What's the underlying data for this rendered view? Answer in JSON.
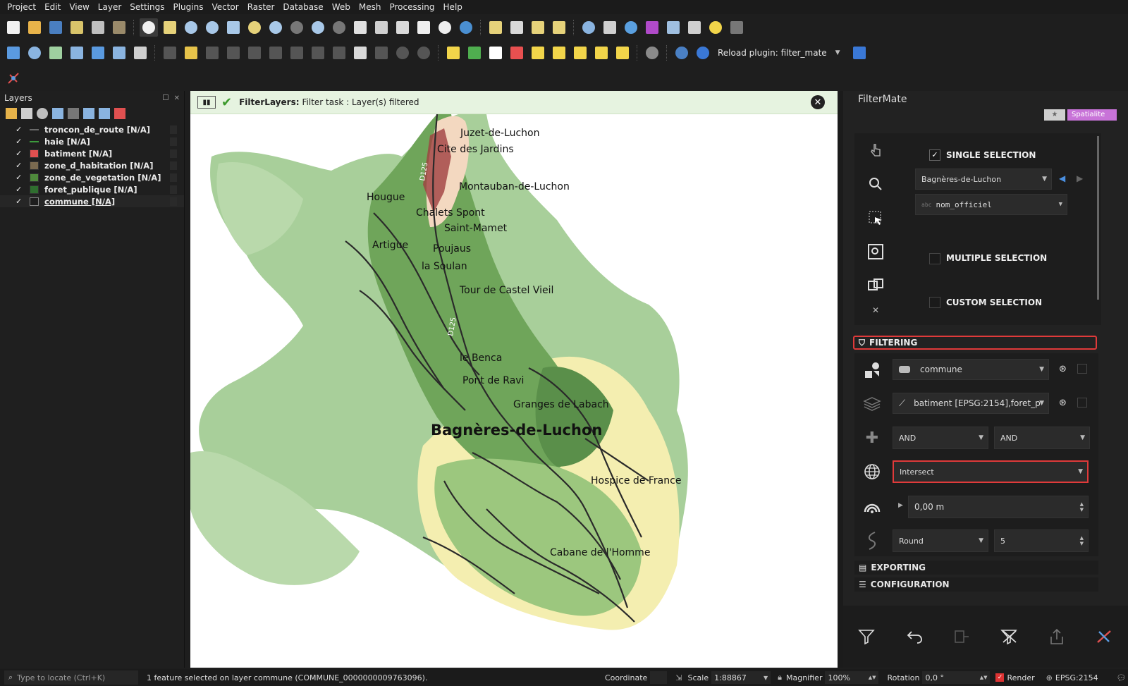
{
  "menubar": {
    "items": [
      "Project",
      "Edit",
      "View",
      "Layer",
      "Settings",
      "Plugins",
      "Vector",
      "Raster",
      "Database",
      "Web",
      "Mesh",
      "Processing",
      "Help"
    ]
  },
  "toolbar2": {
    "reload_label": "Reload plugin: filter_mate"
  },
  "layers_panel": {
    "title": "Layers",
    "layers": [
      {
        "name": "troncon_de_route [N/A]",
        "color": "#6b6b6b",
        "type": "line",
        "checked": true
      },
      {
        "name": "haie [N/A]",
        "color": "#3c9a3c",
        "type": "line",
        "checked": true
      },
      {
        "name": "batiment [N/A]",
        "color": "#e05050",
        "type": "poly",
        "checked": true
      },
      {
        "name": "zone_d_habitation [N/A]",
        "color": "#7a6a50",
        "type": "poly",
        "checked": true
      },
      {
        "name": "zone_de_vegetation [N/A]",
        "color": "#4f8a3c",
        "type": "poly",
        "checked": true
      },
      {
        "name": "foret_publique [N/A]",
        "color": "#2f6e2f",
        "type": "poly",
        "checked": true
      },
      {
        "name": "commune [N/A]",
        "color": "#1e1e1e",
        "type": "poly",
        "checked": true
      }
    ],
    "check_mark": "✓"
  },
  "message_bar": {
    "title": "FilterLayers:",
    "text": "Filter task : Layer(s) filtered"
  },
  "map": {
    "places": [
      "Juzet-de-Luchon",
      "Cite des Jardins",
      "Montauban-de-Luchon",
      "Hougue",
      "Chalets Spont",
      "Saint-Mamet",
      "Artigue",
      "Poujaus",
      "la Soulan",
      "Tour de Castel Vieil",
      "le Benca",
      "Pont de Ravi",
      "Granges de Labach",
      "Hospice de France",
      "Cabane de l'Homme"
    ],
    "main_place": "Bagnères-de-Luchon",
    "road_labels": [
      "D125",
      "D125"
    ]
  },
  "filtermate": {
    "title": "FilterMate",
    "fav_label": "★",
    "backend_label": "Spatialite",
    "single_selection": "SINGLE SELECTION",
    "multiple_selection": "MULTIPLE SELECTION",
    "custom_selection": "CUSTOM SELECTION",
    "single_value": "Bagnères-de-Luchon",
    "field_value": "nom_officiel",
    "field_prefix": "abc",
    "filtering_label": "FILTERING",
    "source_layer": "commune",
    "target_layers": "batiment [EPSG:2154],foret_p",
    "combine_op1": "AND",
    "combine_op2": "AND",
    "predicate": "Intersect",
    "buffer_value": "0,00 m",
    "buffer_type": "Round",
    "segments": "5",
    "exporting_label": "EXPORTING",
    "configuration_label": "CONFIGURATION"
  },
  "statusbar": {
    "locator_placeholder": "Type to locate (Ctrl+K)",
    "message": "1 feature selected on layer commune (COMMUNE_0000000009763096).",
    "coordinate_label": "Coordinate",
    "scale_label": "Scale",
    "scale_value": "1:88867",
    "magnifier_label": "Magnifier",
    "magnifier_value": "100%",
    "rotation_label": "Rotation",
    "rotation_value": "0,0 °",
    "render_label": "Render",
    "crs": "EPSG:2154"
  },
  "colors": {
    "accent_red": "#e03a3a",
    "backend_purple": "#c873d8",
    "message_green": "#e6f3e0"
  }
}
